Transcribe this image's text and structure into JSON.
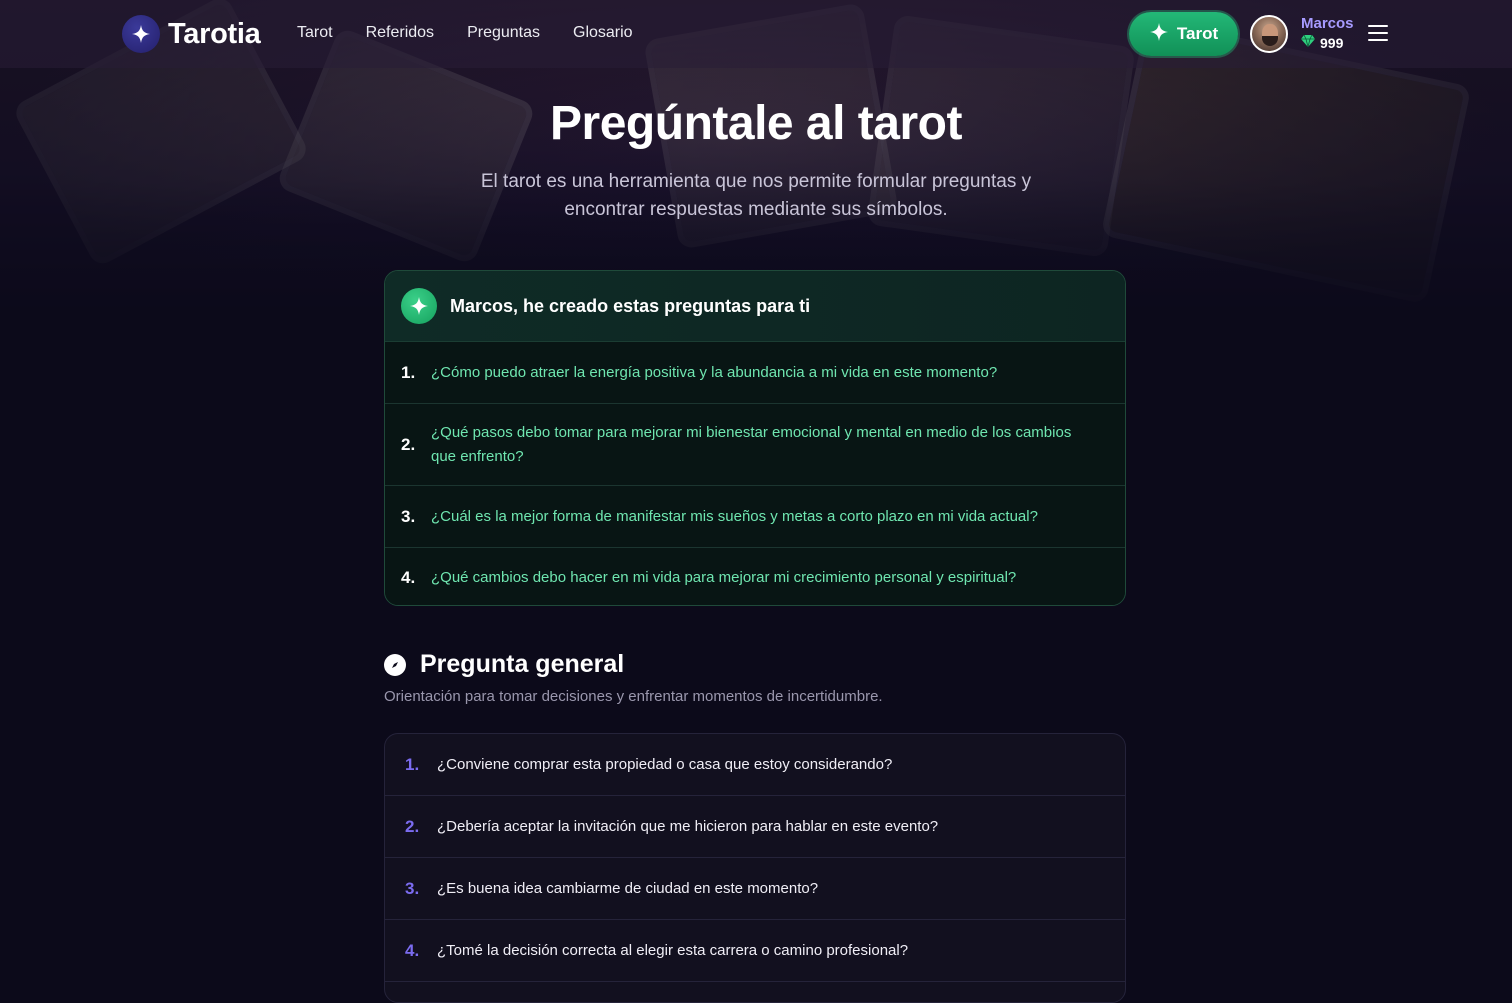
{
  "brand": {
    "name": "Tarotia"
  },
  "nav": {
    "links": [
      "Tarot",
      "Referidos",
      "Preguntas",
      "Glosario"
    ],
    "cta_label": "Tarot"
  },
  "user": {
    "name": "Marcos",
    "gems": "999"
  },
  "hero": {
    "title": "Pregúntale al tarot",
    "subtitle": "El tarot es una herramienta que nos permite formular preguntas y encontrar respuestas mediante sus símbolos."
  },
  "ai_card": {
    "title": "Marcos, he creado estas preguntas para ti",
    "questions": [
      {
        "num": "1.",
        "text": "¿Cómo puedo atraer la energía positiva y la abundancia a mi vida en este momento?"
      },
      {
        "num": "2.",
        "text": "¿Qué pasos debo tomar para mejorar mi bienestar emocional y mental en medio de los cambios que enfrento?"
      },
      {
        "num": "3.",
        "text": "¿Cuál es la mejor forma de manifestar mis sueños y metas a corto plazo en mi vida actual?"
      },
      {
        "num": "4.",
        "text": "¿Qué cambios debo hacer en mi vida para mejorar mi crecimiento personal y espiritual?"
      }
    ]
  },
  "general": {
    "title": "Pregunta general",
    "description": "Orientación para tomar decisiones y enfrentar momentos de incertidumbre.",
    "questions": [
      {
        "num": "1.",
        "text": "¿Conviene comprar esta propiedad o casa que estoy considerando?"
      },
      {
        "num": "2.",
        "text": "¿Debería aceptar la invitación que me hicieron para hablar en este evento?"
      },
      {
        "num": "3.",
        "text": "¿Es buena idea cambiarme de ciudad en este momento?"
      },
      {
        "num": "4.",
        "text": "¿Tomé la decisión correcta al elegir esta carrera o camino profesional?"
      }
    ]
  },
  "colors": {
    "accent_green": "#1fae6c",
    "question_green": "#6fe6b0",
    "accent_purple": "#7b6cf0",
    "username_purple": "#a79bff"
  }
}
